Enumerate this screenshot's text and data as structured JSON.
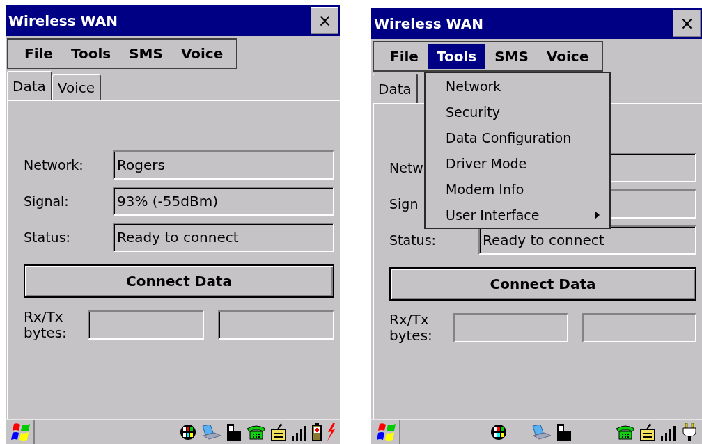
{
  "screens": [
    {
      "window": {
        "title": "Wireless WAN",
        "close": "×"
      },
      "menu": [
        {
          "label": "File",
          "selected": false
        },
        {
          "label": "Tools",
          "selected": false
        },
        {
          "label": "SMS",
          "selected": false
        },
        {
          "label": "Voice",
          "selected": false
        }
      ],
      "tabs": [
        {
          "label": "Data",
          "selected": true
        },
        {
          "label": "Voice",
          "selected": false
        }
      ],
      "fields": [
        {
          "label": "Network:",
          "value": "Rogers"
        },
        {
          "label": "Signal:",
          "value": "93% (-55dBm)"
        },
        {
          "label": "Status:",
          "value": "Ready to connect"
        }
      ],
      "button": {
        "label": "Connect Data"
      },
      "rxtx": {
        "label": "Rx/Tx bytes:"
      },
      "tray_icons": [
        {
          "kind": "palette"
        },
        {
          "kind": "computer"
        },
        {
          "kind": "card"
        },
        {
          "kind": "phone"
        },
        {
          "kind": "box"
        },
        {
          "kind": "signal"
        },
        {
          "kind": "battery"
        },
        {
          "kind": "bolt"
        }
      ]
    },
    {
      "window": {
        "title": "Wireless WAN",
        "close": "×"
      },
      "menu": [
        {
          "label": "File",
          "selected": false
        },
        {
          "label": "Tools",
          "selected": true
        },
        {
          "label": "SMS",
          "selected": false
        },
        {
          "label": "Voice",
          "selected": false
        }
      ],
      "tabs": [
        {
          "label": "Data",
          "selected": true
        }
      ],
      "fields": [
        {
          "label": "Netw"
        },
        {
          "label": "Sign"
        },
        {
          "label": "Status:",
          "value": "Ready to connect"
        }
      ],
      "button": {
        "label": "Connect Data"
      },
      "rxtx": {
        "label": "Rx/Tx bytes:"
      },
      "dropdown": [
        {
          "label": "Network",
          "submenu": false
        },
        {
          "label": "Security",
          "submenu": false
        },
        {
          "label": "Data Configuration",
          "submenu": false
        },
        {
          "label": "Driver Mode",
          "submenu": false
        },
        {
          "label": "Modem Info",
          "submenu": false
        },
        {
          "label": "User Interface",
          "submenu": true
        }
      ],
      "tray_icons": [
        {
          "kind": "spacer"
        },
        {
          "kind": "palette"
        },
        {
          "kind": "spacer"
        },
        {
          "kind": "computer"
        },
        {
          "kind": "card"
        },
        {
          "kind": "spacer"
        },
        {
          "kind": "spacer"
        },
        {
          "kind": "phone"
        },
        {
          "kind": "box"
        },
        {
          "kind": "signal"
        },
        {
          "kind": "plug"
        }
      ]
    }
  ]
}
